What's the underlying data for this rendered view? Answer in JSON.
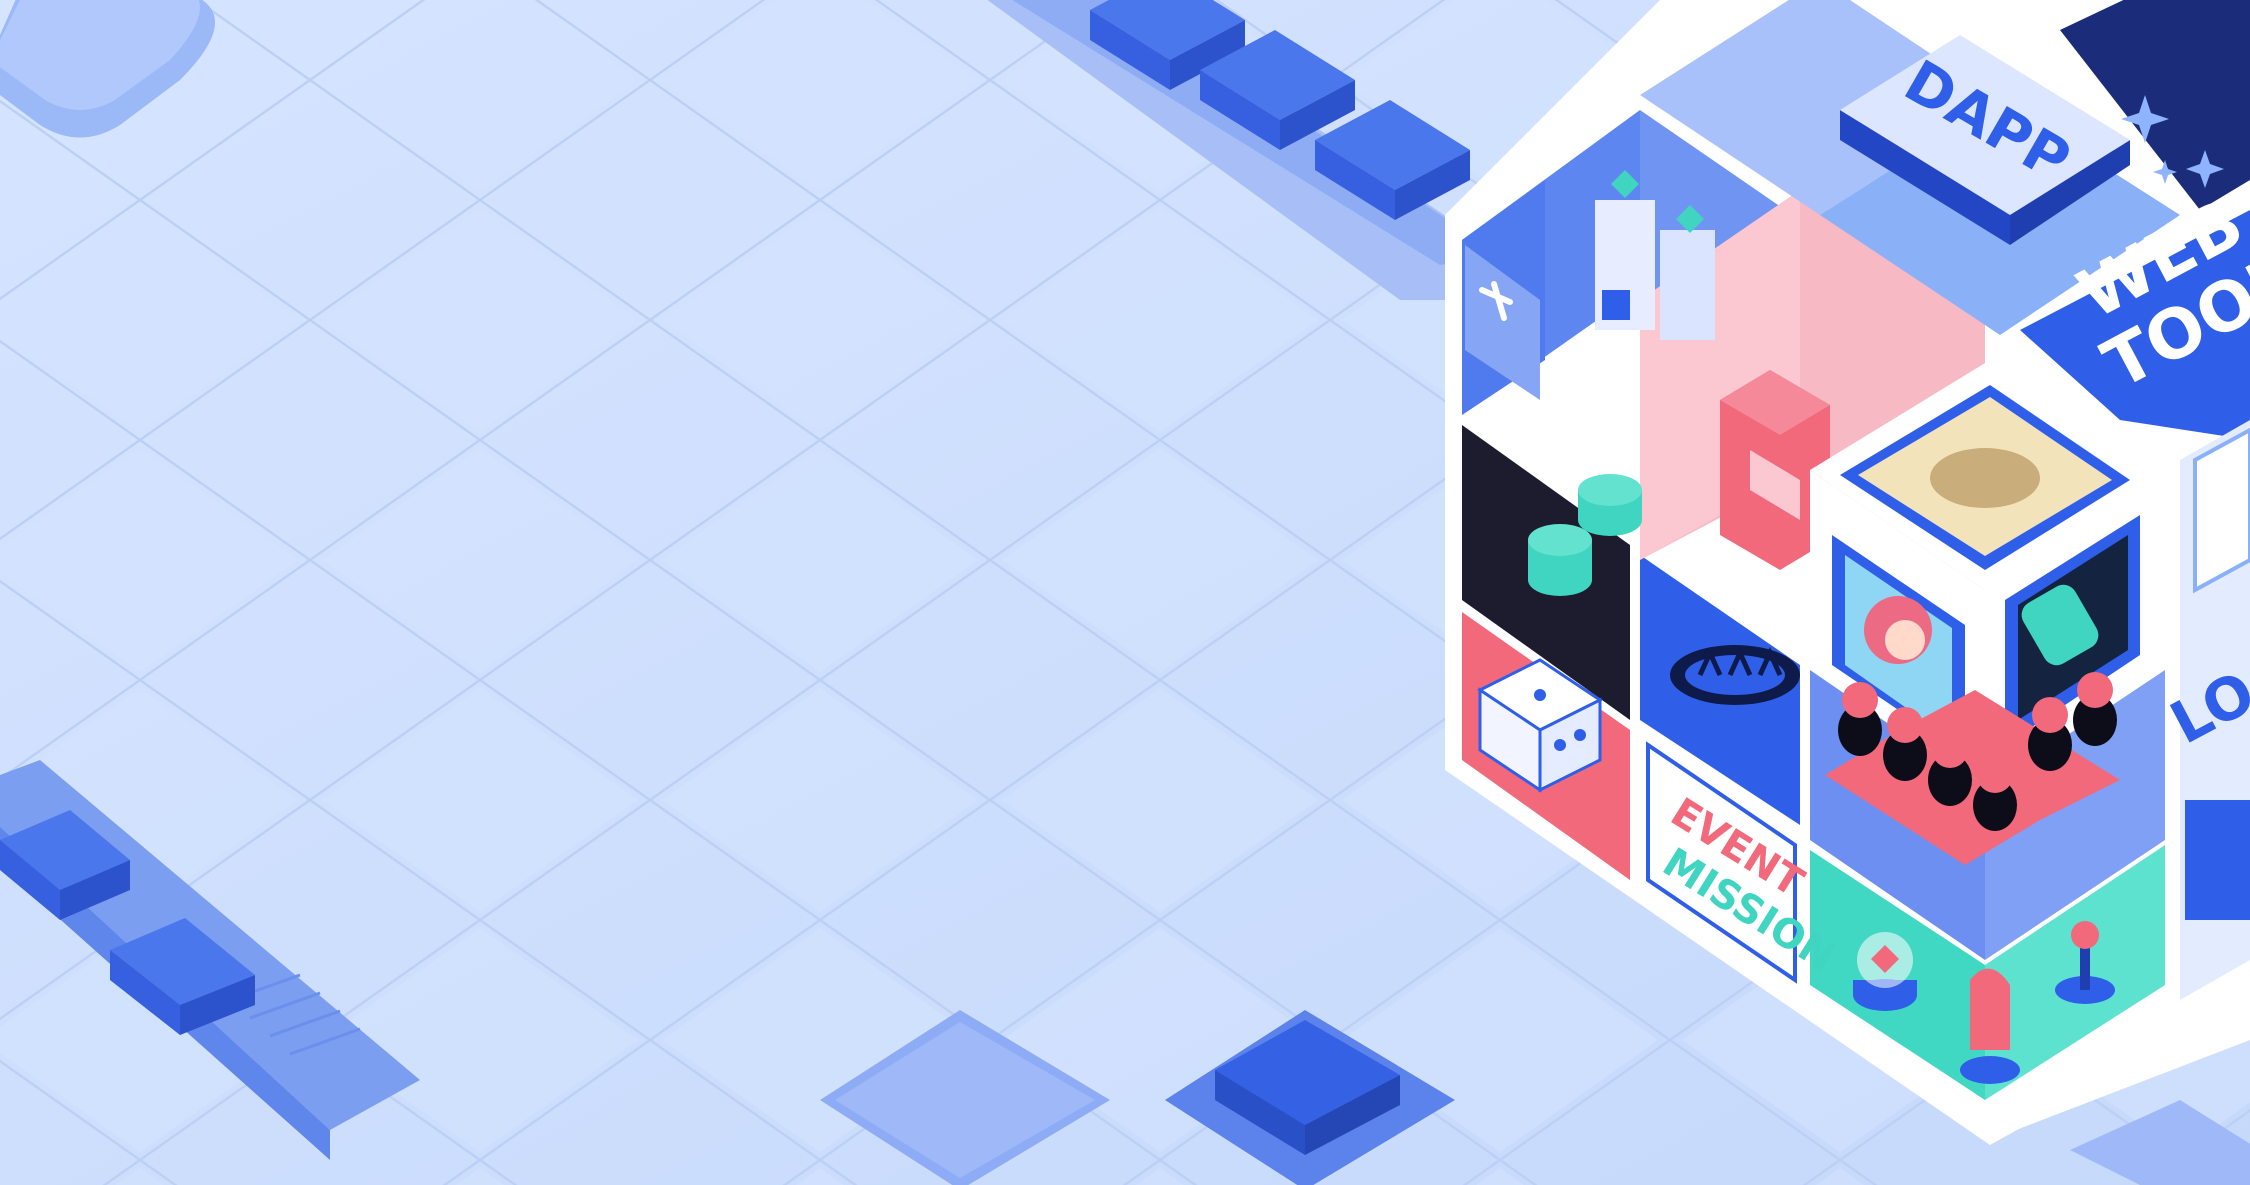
{
  "scene": {
    "background_color": "#cfe0fd",
    "grid_color": "#bdd1f6",
    "accent_blue": "#2f5ee8",
    "accent_pink": "#f1697b",
    "accent_teal": "#3fd5c0"
  },
  "cube": {
    "top_badge": "DAPP",
    "webtoon_line1": "WEB",
    "webtoon_line2": "TOON",
    "event_line1": "EVENT",
    "event_line2": "MISSION",
    "side_text": "LOA",
    "icons": [
      "pickaxe-icon",
      "coin-stack-icon",
      "dice-icon",
      "crown-icon",
      "game-controller-icon",
      "star-sparkle-icon"
    ]
  }
}
